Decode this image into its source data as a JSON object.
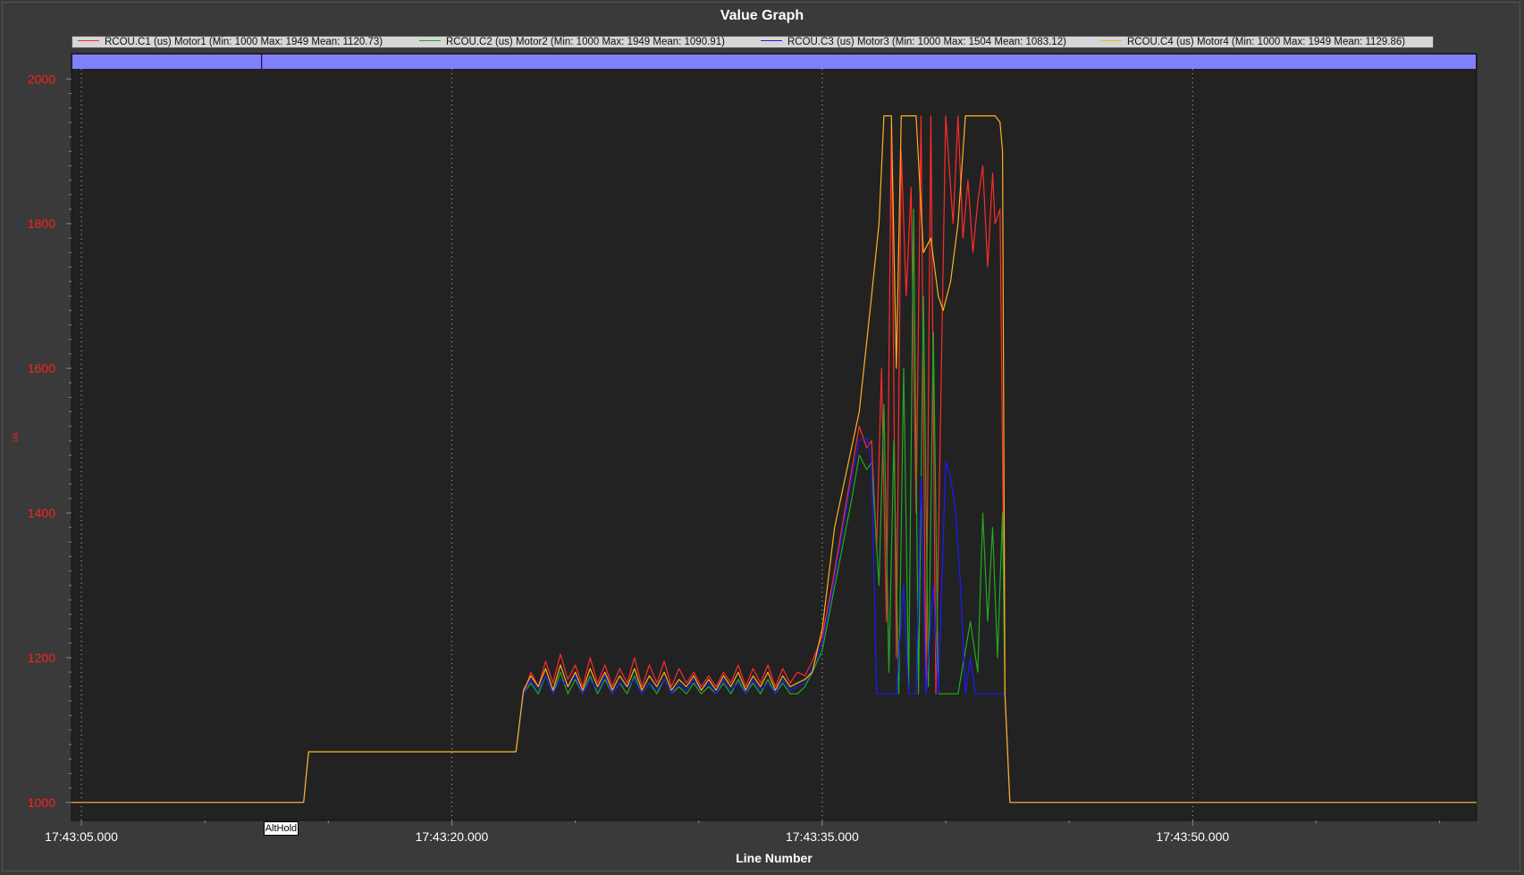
{
  "colors": {
    "plot_bg": "#222222",
    "grid": "#bbbbbb",
    "yaxis_text": "#ff2020",
    "xaxis_text": "#ffffff",
    "mode_bar": "#8080ff",
    "series": [
      "#ff2b2b",
      "#22aa22",
      "#1a1aff",
      "#ffb020"
    ]
  },
  "chart_data": {
    "type": "line",
    "title": "Value Graph",
    "xlabel": "Line Number",
    "ylabel": "us",
    "x_ticks": [
      "17:43:05.000",
      "17:43:20.000",
      "17:43:35.000",
      "17:43:50.000"
    ],
    "x_tick_seconds": [
      5,
      20,
      35,
      50
    ],
    "xlim": [
      4.6,
      61.5
    ],
    "ylim": [
      975,
      2035
    ],
    "y_ticks": [
      1000,
      1200,
      1400,
      1600,
      1800,
      2000
    ],
    "grid": "vertical-dotted",
    "legend_placement": "top",
    "mode_markers": [
      {
        "label": "AltHold",
        "x": 12.3
      }
    ],
    "series": [
      {
        "name": "RCOU.C1 (us) Motor1 (Min: 1000 Max: 1949 Mean: 1120.73)",
        "points": [
          [
            4.6,
            1000
          ],
          [
            14.0,
            1000
          ],
          [
            14.2,
            1070
          ],
          [
            22.6,
            1070
          ],
          [
            22.9,
            1150
          ],
          [
            23.2,
            1180
          ],
          [
            23.5,
            1160
          ],
          [
            23.8,
            1195
          ],
          [
            24.1,
            1165
          ],
          [
            24.4,
            1205
          ],
          [
            24.7,
            1170
          ],
          [
            25.0,
            1190
          ],
          [
            25.3,
            1160
          ],
          [
            25.6,
            1200
          ],
          [
            25.9,
            1165
          ],
          [
            26.2,
            1190
          ],
          [
            26.5,
            1160
          ],
          [
            26.8,
            1185
          ],
          [
            27.1,
            1165
          ],
          [
            27.4,
            1200
          ],
          [
            27.7,
            1160
          ],
          [
            28.0,
            1190
          ],
          [
            28.3,
            1165
          ],
          [
            28.6,
            1195
          ],
          [
            28.9,
            1160
          ],
          [
            29.2,
            1185
          ],
          [
            29.5,
            1165
          ],
          [
            29.8,
            1180
          ],
          [
            30.1,
            1160
          ],
          [
            30.4,
            1175
          ],
          [
            30.7,
            1160
          ],
          [
            31.0,
            1180
          ],
          [
            31.3,
            1165
          ],
          [
            31.6,
            1190
          ],
          [
            31.9,
            1160
          ],
          [
            32.2,
            1185
          ],
          [
            32.5,
            1165
          ],
          [
            32.8,
            1190
          ],
          [
            33.1,
            1160
          ],
          [
            33.4,
            1185
          ],
          [
            33.7,
            1165
          ],
          [
            34.0,
            1180
          ],
          [
            34.3,
            1175
          ],
          [
            34.6,
            1195
          ],
          [
            35.0,
            1230
          ],
          [
            35.4,
            1300
          ],
          [
            35.8,
            1380
          ],
          [
            36.2,
            1460
          ],
          [
            36.5,
            1520
          ],
          [
            36.8,
            1490
          ],
          [
            37.0,
            1500
          ],
          [
            37.2,
            1350
          ],
          [
            37.4,
            1600
          ],
          [
            37.6,
            1250
          ],
          [
            37.8,
            1940
          ],
          [
            38.0,
            1200
          ],
          [
            38.2,
            1900
          ],
          [
            38.4,
            1700
          ],
          [
            38.6,
            1850
          ],
          [
            38.8,
            1400
          ],
          [
            39.0,
            1949
          ],
          [
            39.2,
            1150
          ],
          [
            39.4,
            1949
          ],
          [
            39.6,
            1150
          ],
          [
            40.0,
            1949
          ],
          [
            40.3,
            1800
          ],
          [
            40.5,
            1949
          ],
          [
            40.7,
            1780
          ],
          [
            40.9,
            1860
          ],
          [
            41.1,
            1760
          ],
          [
            41.3,
            1830
          ],
          [
            41.5,
            1880
          ],
          [
            41.7,
            1740
          ],
          [
            41.9,
            1870
          ],
          [
            42.0,
            1800
          ],
          [
            42.2,
            1820
          ],
          [
            42.4,
            1150
          ],
          [
            42.6,
            1000
          ],
          [
            61.5,
            1000
          ]
        ]
      },
      {
        "name": "RCOU.C2 (us) Motor2 (Min: 1000 Max: 1949 Mean: 1090.91)",
        "points": [
          [
            4.6,
            1000
          ],
          [
            14.0,
            1000
          ],
          [
            14.2,
            1070
          ],
          [
            22.6,
            1070
          ],
          [
            22.9,
            1150
          ],
          [
            23.2,
            1165
          ],
          [
            23.5,
            1150
          ],
          [
            23.8,
            1175
          ],
          [
            24.1,
            1150
          ],
          [
            24.4,
            1180
          ],
          [
            24.7,
            1150
          ],
          [
            25.0,
            1170
          ],
          [
            25.3,
            1150
          ],
          [
            25.6,
            1175
          ],
          [
            25.9,
            1150
          ],
          [
            26.2,
            1170
          ],
          [
            26.5,
            1150
          ],
          [
            26.8,
            1165
          ],
          [
            27.1,
            1150
          ],
          [
            27.4,
            1175
          ],
          [
            27.7,
            1150
          ],
          [
            28.0,
            1165
          ],
          [
            28.3,
            1150
          ],
          [
            28.6,
            1170
          ],
          [
            28.9,
            1150
          ],
          [
            29.2,
            1160
          ],
          [
            29.5,
            1150
          ],
          [
            29.8,
            1165
          ],
          [
            30.1,
            1150
          ],
          [
            30.4,
            1160
          ],
          [
            30.7,
            1150
          ],
          [
            31.0,
            1165
          ],
          [
            31.3,
            1150
          ],
          [
            31.6,
            1170
          ],
          [
            31.9,
            1150
          ],
          [
            32.2,
            1165
          ],
          [
            32.5,
            1150
          ],
          [
            32.8,
            1170
          ],
          [
            33.1,
            1150
          ],
          [
            33.4,
            1165
          ],
          [
            33.7,
            1150
          ],
          [
            34.0,
            1150
          ],
          [
            34.3,
            1160
          ],
          [
            34.6,
            1180
          ],
          [
            35.0,
            1210
          ],
          [
            35.4,
            1280
          ],
          [
            35.8,
            1350
          ],
          [
            36.2,
            1420
          ],
          [
            36.5,
            1480
          ],
          [
            36.8,
            1460
          ],
          [
            37.0,
            1470
          ],
          [
            37.3,
            1300
          ],
          [
            37.5,
            1550
          ],
          [
            37.7,
            1180
          ],
          [
            37.9,
            1500
          ],
          [
            38.1,
            1150
          ],
          [
            38.3,
            1600
          ],
          [
            38.5,
            1160
          ],
          [
            38.7,
            1820
          ],
          [
            38.9,
            1150
          ],
          [
            39.1,
            1700
          ],
          [
            39.3,
            1160
          ],
          [
            39.5,
            1650
          ],
          [
            39.7,
            1150
          ],
          [
            40.0,
            1150
          ],
          [
            40.5,
            1150
          ],
          [
            41.0,
            1250
          ],
          [
            41.3,
            1180
          ],
          [
            41.5,
            1400
          ],
          [
            41.7,
            1250
          ],
          [
            41.9,
            1380
          ],
          [
            42.1,
            1200
          ],
          [
            42.3,
            1400
          ],
          [
            42.4,
            1150
          ],
          [
            42.6,
            1000
          ],
          [
            61.5,
            1000
          ]
        ]
      },
      {
        "name": "RCOU.C3 (us) Motor3 (Min: 1000 Max: 1504 Mean: 1083.12)",
        "points": [
          [
            4.6,
            1000
          ],
          [
            14.0,
            1000
          ],
          [
            14.2,
            1070
          ],
          [
            22.6,
            1070
          ],
          [
            22.9,
            1150
          ],
          [
            23.2,
            1170
          ],
          [
            23.5,
            1155
          ],
          [
            23.8,
            1175
          ],
          [
            24.1,
            1150
          ],
          [
            24.4,
            1170
          ],
          [
            24.7,
            1160
          ],
          [
            25.0,
            1175
          ],
          [
            25.3,
            1150
          ],
          [
            25.6,
            1170
          ],
          [
            25.9,
            1155
          ],
          [
            26.2,
            1175
          ],
          [
            26.5,
            1150
          ],
          [
            26.8,
            1165
          ],
          [
            27.1,
            1160
          ],
          [
            27.4,
            1170
          ],
          [
            27.7,
            1150
          ],
          [
            28.0,
            1165
          ],
          [
            28.3,
            1155
          ],
          [
            28.6,
            1170
          ],
          [
            28.9,
            1150
          ],
          [
            29.2,
            1165
          ],
          [
            29.5,
            1155
          ],
          [
            29.8,
            1170
          ],
          [
            30.1,
            1155
          ],
          [
            30.4,
            1165
          ],
          [
            30.7,
            1150
          ],
          [
            31.0,
            1170
          ],
          [
            31.3,
            1155
          ],
          [
            31.6,
            1165
          ],
          [
            31.9,
            1150
          ],
          [
            32.2,
            1170
          ],
          [
            32.5,
            1155
          ],
          [
            32.8,
            1165
          ],
          [
            33.1,
            1150
          ],
          [
            33.4,
            1170
          ],
          [
            33.7,
            1155
          ],
          [
            34.0,
            1160
          ],
          [
            34.3,
            1165
          ],
          [
            34.6,
            1185
          ],
          [
            35.0,
            1220
          ],
          [
            35.4,
            1290
          ],
          [
            35.8,
            1370
          ],
          [
            36.2,
            1450
          ],
          [
            36.5,
            1500
          ],
          [
            36.8,
            1504
          ],
          [
            37.0,
            1470
          ],
          [
            37.2,
            1150
          ],
          [
            38.0,
            1150
          ],
          [
            38.3,
            1300
          ],
          [
            38.5,
            1150
          ],
          [
            38.8,
            1150
          ],
          [
            39.0,
            1450
          ],
          [
            39.2,
            1150
          ],
          [
            39.5,
            1300
          ],
          [
            39.7,
            1150
          ],
          [
            40.0,
            1470
          ],
          [
            40.2,
            1450
          ],
          [
            40.4,
            1400
          ],
          [
            40.6,
            1300
          ],
          [
            40.8,
            1150
          ],
          [
            41.0,
            1200
          ],
          [
            41.2,
            1150
          ],
          [
            42.4,
            1150
          ],
          [
            42.6,
            1000
          ],
          [
            61.5,
            1000
          ]
        ]
      },
      {
        "name": "RCOU.C4 (us) Motor4 (Min: 1000 Max: 1949 Mean: 1129.86)",
        "points": [
          [
            4.6,
            1000
          ],
          [
            14.0,
            1000
          ],
          [
            14.2,
            1070
          ],
          [
            22.6,
            1070
          ],
          [
            22.9,
            1155
          ],
          [
            23.2,
            1175
          ],
          [
            23.5,
            1160
          ],
          [
            23.8,
            1185
          ],
          [
            24.1,
            1155
          ],
          [
            24.4,
            1190
          ],
          [
            24.7,
            1160
          ],
          [
            25.0,
            1180
          ],
          [
            25.3,
            1155
          ],
          [
            25.6,
            1185
          ],
          [
            25.9,
            1160
          ],
          [
            26.2,
            1180
          ],
          [
            26.5,
            1155
          ],
          [
            26.8,
            1175
          ],
          [
            27.1,
            1160
          ],
          [
            27.4,
            1185
          ],
          [
            27.7,
            1155
          ],
          [
            28.0,
            1175
          ],
          [
            28.3,
            1160
          ],
          [
            28.6,
            1180
          ],
          [
            28.9,
            1155
          ],
          [
            29.2,
            1170
          ],
          [
            29.5,
            1160
          ],
          [
            29.8,
            1175
          ],
          [
            30.1,
            1155
          ],
          [
            30.4,
            1170
          ],
          [
            30.7,
            1155
          ],
          [
            31.0,
            1175
          ],
          [
            31.3,
            1160
          ],
          [
            31.6,
            1180
          ],
          [
            31.9,
            1155
          ],
          [
            32.2,
            1175
          ],
          [
            32.5,
            1160
          ],
          [
            32.8,
            1180
          ],
          [
            33.1,
            1155
          ],
          [
            33.4,
            1175
          ],
          [
            33.7,
            1160
          ],
          [
            34.0,
            1165
          ],
          [
            34.3,
            1170
          ],
          [
            34.6,
            1180
          ],
          [
            35.0,
            1240
          ],
          [
            35.5,
            1380
          ],
          [
            36.0,
            1460
          ],
          [
            36.5,
            1540
          ],
          [
            37.0,
            1700
          ],
          [
            37.3,
            1800
          ],
          [
            37.5,
            1949
          ],
          [
            37.8,
            1949
          ],
          [
            38.0,
            1600
          ],
          [
            38.2,
            1949
          ],
          [
            38.5,
            1949
          ],
          [
            38.8,
            1949
          ],
          [
            39.1,
            1760
          ],
          [
            39.4,
            1780
          ],
          [
            39.7,
            1700
          ],
          [
            39.9,
            1680
          ],
          [
            40.2,
            1720
          ],
          [
            40.5,
            1800
          ],
          [
            40.8,
            1949
          ],
          [
            41.2,
            1949
          ],
          [
            41.5,
            1949
          ],
          [
            42.0,
            1949
          ],
          [
            42.2,
            1940
          ],
          [
            42.3,
            1900
          ],
          [
            42.4,
            1150
          ],
          [
            42.6,
            1000
          ],
          [
            61.5,
            1000
          ]
        ]
      }
    ]
  }
}
